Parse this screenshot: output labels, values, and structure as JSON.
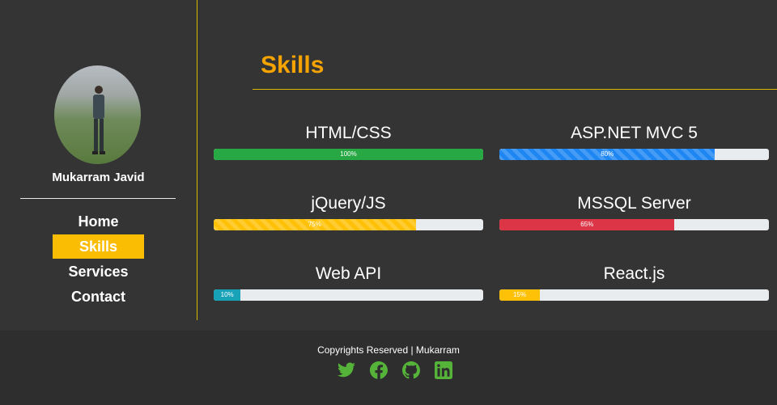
{
  "profile": {
    "name": "Mukarram Javid"
  },
  "nav": {
    "items": [
      {
        "label": "Home",
        "active": false
      },
      {
        "label": "Skills",
        "active": true
      },
      {
        "label": "Services",
        "active": false
      },
      {
        "label": "Contact",
        "active": false
      }
    ]
  },
  "section": {
    "title": "Skills"
  },
  "skills": [
    {
      "name": "HTML/CSS",
      "percent": 100,
      "label": "100%",
      "color": "#28a745",
      "striped": false
    },
    {
      "name": "ASP.NET MVC 5",
      "percent": 80,
      "label": "80%",
      "color": "#1d86f2",
      "striped": true
    },
    {
      "name": "jQuery/JS",
      "percent": 75,
      "label": "75%",
      "color": "#ffc107",
      "striped": true
    },
    {
      "name": "MSSQL Server",
      "percent": 65,
      "label": "65%",
      "color": "#dc3545",
      "striped": false
    },
    {
      "name": "Web API",
      "percent": 10,
      "label": "10%",
      "color": "#17a2b8",
      "striped": false
    },
    {
      "name": "React.js",
      "percent": 15,
      "label": "15%",
      "color": "#ffc107",
      "striped": false
    }
  ],
  "footer": {
    "copyright": "Copyrights Reserved | Mukarram",
    "icon_color": "#56b33a",
    "socials": [
      "twitter-icon",
      "facebook-icon",
      "github-icon",
      "linkedin-icon"
    ]
  },
  "colors": {
    "background": "#343434",
    "accent": "#fbbc04",
    "title": "#f4a300",
    "rule": "#d8b800"
  }
}
